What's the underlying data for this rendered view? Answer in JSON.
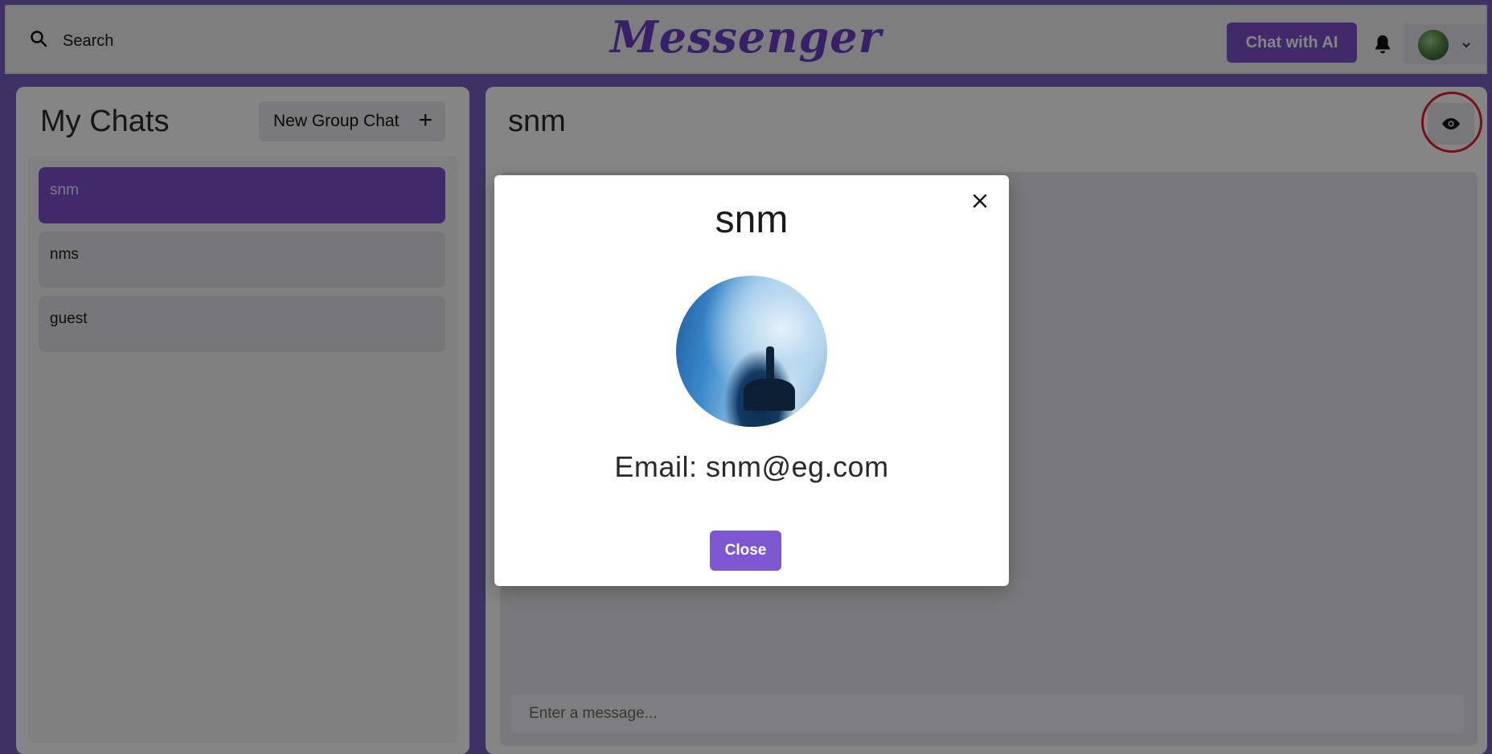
{
  "header": {
    "search_label": "Search",
    "brand": "Messenger",
    "chat_ai_label": "Chat with AI"
  },
  "left_panel": {
    "title": "My Chats",
    "new_group_label": "New Group Chat",
    "new_group_icon": "+",
    "chats": [
      {
        "name": "snm",
        "active": true
      },
      {
        "name": "nms",
        "active": false
      },
      {
        "name": "guest",
        "active": false
      }
    ]
  },
  "right_panel": {
    "chat_name": "snm",
    "message_placeholder": "Enter a message..."
  },
  "modal": {
    "title": "snm",
    "email": "Email: snm@eg.com",
    "close_label": "Close"
  },
  "colors": {
    "accent": "#7b52c9",
    "highlight_ring": "#e0212a"
  }
}
